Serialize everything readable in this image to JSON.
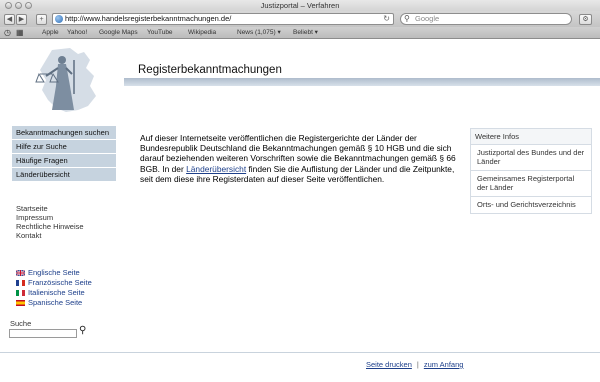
{
  "window": {
    "title": "Justizportal – Verfahren"
  },
  "browser": {
    "url": "http://www.handelsregisterbekanntmachungen.de/",
    "search_placeholder": "Google",
    "bookmarks": [
      "Apple",
      "Yahoo!",
      "Google Maps",
      "YouTube",
      "Wikipedia",
      "News (1,075) ▾",
      "Beliebt ▾"
    ]
  },
  "header": {
    "title": "Registerbekanntmachungen"
  },
  "nav": {
    "items": [
      {
        "label": "Bekanntmachungen suchen"
      },
      {
        "label": "Hilfe zur Suche"
      },
      {
        "label": "Häufige Fragen"
      },
      {
        "label": "Länderübersicht"
      }
    ]
  },
  "links": {
    "items": [
      "Startseite",
      "Impressum",
      "Rechtliche Hinweise",
      "Kontakt"
    ]
  },
  "languages": {
    "items": [
      "Englische Seite",
      "Französische Seite",
      "Italienische Seite",
      "Spanische Seite"
    ]
  },
  "search": {
    "label": "Suche",
    "value": ""
  },
  "main": {
    "text_before": "Auf dieser Internetseite veröffentlichen die Registergerichte der Länder der Bundesrepublik Deutschland die Bekanntmachungen gemäß § 10 HGB und die sich darauf beziehenden weiteren Vorschriften sowie die Bekanntmachungen gemäß § 66 BGB. In der ",
    "link": "Länderübersicht",
    "text_after": " finden Sie die Auflistung der Länder und die Zeitpunkte, seit dem diese ihre Registerdaten auf dieser Seite veröffentlichen."
  },
  "aside": {
    "heading": "Weitere Infos",
    "items": [
      {
        "label": "Justizportal des Bundes und der Länder"
      },
      {
        "label": "Gemeinsames Registerportal der Länder"
      },
      {
        "label": "Orts- und Gerichtsverzeichnis"
      }
    ]
  },
  "footer": {
    "print": "Seite drucken",
    "top": "zum Anfang",
    "separator": "|"
  }
}
